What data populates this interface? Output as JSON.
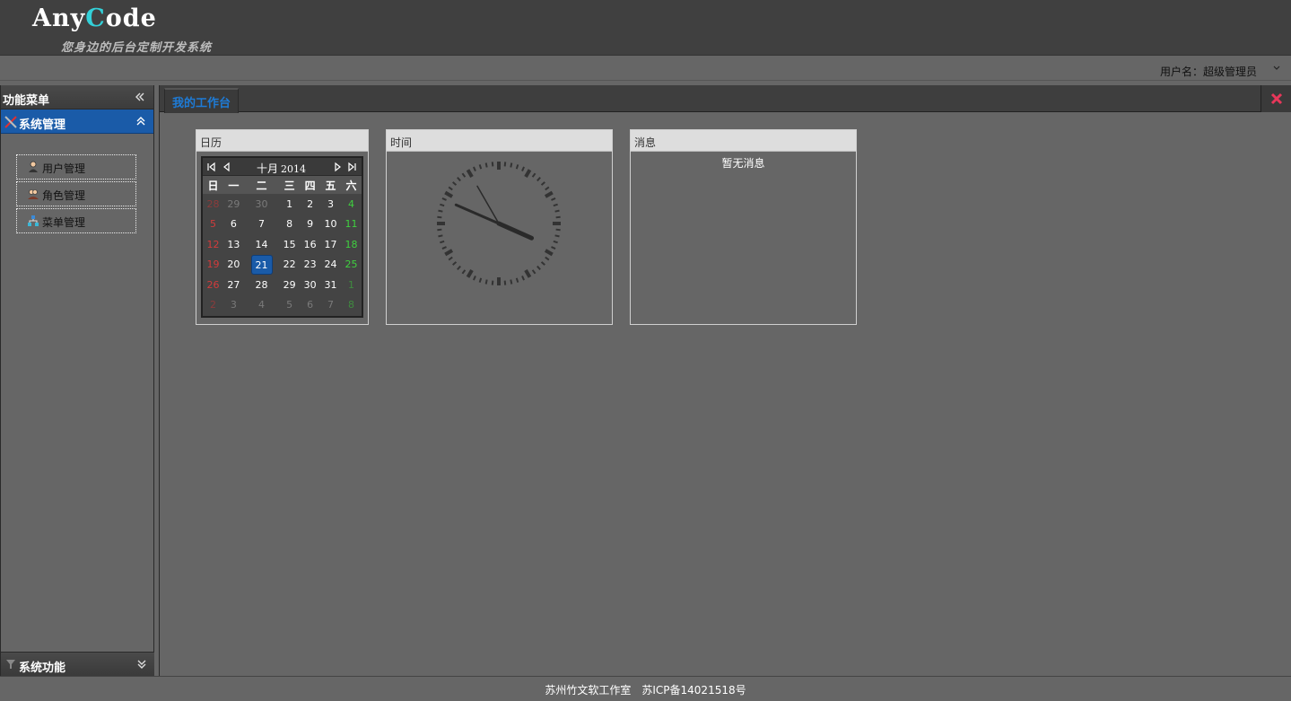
{
  "header": {
    "logo_part1": "Any",
    "logo_c": "C",
    "logo_part2": "ode",
    "tagline": "您身边的后台定制开发系统",
    "username": "用户名：超级管理员"
  },
  "sidebar": {
    "title": "功能菜单",
    "group": "系统管理",
    "items": [
      {
        "label": "用户管理",
        "icon": "user-icon"
      },
      {
        "label": "角色管理",
        "icon": "role-icon"
      },
      {
        "label": "菜单管理",
        "icon": "menu-icon"
      }
    ],
    "footer_group": "系统功能"
  },
  "tabs": [
    {
      "label": "我的工作台"
    }
  ],
  "panels": {
    "calendar": {
      "title": "日历",
      "month": "十月",
      "year": "2014",
      "weekdays": [
        "日",
        "一",
        "二",
        "三",
        "四",
        "五",
        "六"
      ],
      "weeks": [
        [
          "28",
          "29",
          "30",
          "1",
          "2",
          "3",
          "4"
        ],
        [
          "5",
          "6",
          "7",
          "8",
          "9",
          "10",
          "11"
        ],
        [
          "12",
          "13",
          "14",
          "15",
          "16",
          "17",
          "18"
        ],
        [
          "19",
          "20",
          "21",
          "22",
          "23",
          "24",
          "25"
        ],
        [
          "26",
          "27",
          "28",
          "29",
          "30",
          "31",
          "1"
        ],
        [
          "2",
          "3",
          "4",
          "5",
          "6",
          "7",
          "8"
        ]
      ],
      "selected_day": "21"
    },
    "clock": {
      "title": "时间",
      "hour": 3,
      "minute": 48,
      "second": 55
    },
    "messages": {
      "title": "消息",
      "empty_text": "暂无消息"
    }
  },
  "footer": {
    "text": "苏州竹文软工作室　苏ICP备14021518号"
  },
  "colors": {
    "accent": "#1a5ba8",
    "tab_text": "#1e7bd6",
    "close_icon": "#e8375a",
    "logo_c": "#33d0d8"
  }
}
